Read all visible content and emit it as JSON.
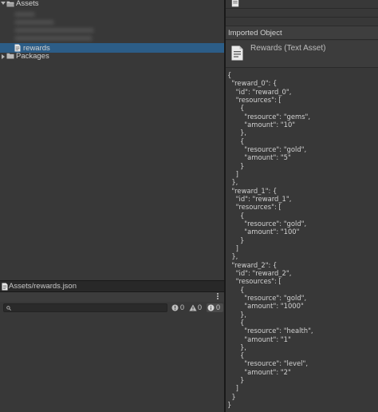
{
  "project": {
    "assets_label": "Assets",
    "packages_label": "Packages",
    "selected_file_label": "rewards"
  },
  "path_bar": {
    "path_text": "Assets/rewards.json"
  },
  "console": {
    "search_placeholder": "",
    "error_count": "0",
    "warning_count": "0",
    "info_count": "0"
  },
  "inspector": {
    "section_title": "Imported Object",
    "asset_title": "Rewards (Text Asset)",
    "json_lines": [
      "{",
      "  \"reward_0\": {",
      "    \"id\": \"reward_0\",",
      "    \"resources\": [",
      "      {",
      "        \"resource\": \"gems\",",
      "        \"amount\": \"10\"",
      "      },",
      "      {",
      "        \"resource\": \"gold\",",
      "        \"amount\": \"5\"",
      "      }",
      "    ]",
      "  },",
      "  \"reward_1\": {",
      "    \"id\": \"reward_1\",",
      "    \"resources\": [",
      "      {",
      "        \"resource\": \"gold\",",
      "        \"amount\": \"100\"",
      "      }",
      "    ]",
      "  },",
      "  \"reward_2\": {",
      "    \"id\": \"reward_2\",",
      "    \"resources\": [",
      "      {",
      "        \"resource\": \"gold\",",
      "        \"amount\": \"1000\"",
      "      },",
      "      {",
      "        \"resource\": \"health\",",
      "        \"amount\": \"1\"",
      "      },",
      "      {",
      "        \"resource\": \"level\",",
      "        \"amount\": \"2\"",
      "      }",
      "    ]",
      "  }",
      "}"
    ]
  },
  "icons": {
    "folder": "folder-icon",
    "file": "text-file-icon",
    "search": "search-icon",
    "error": "error-icon",
    "warning": "warning-icon",
    "info": "info-icon",
    "menu": "kebab-menu-icon"
  },
  "colors": {
    "selection": "#2c5d87",
    "panel": "#383838",
    "border": "#191919",
    "text": "#d2d2d2"
  }
}
